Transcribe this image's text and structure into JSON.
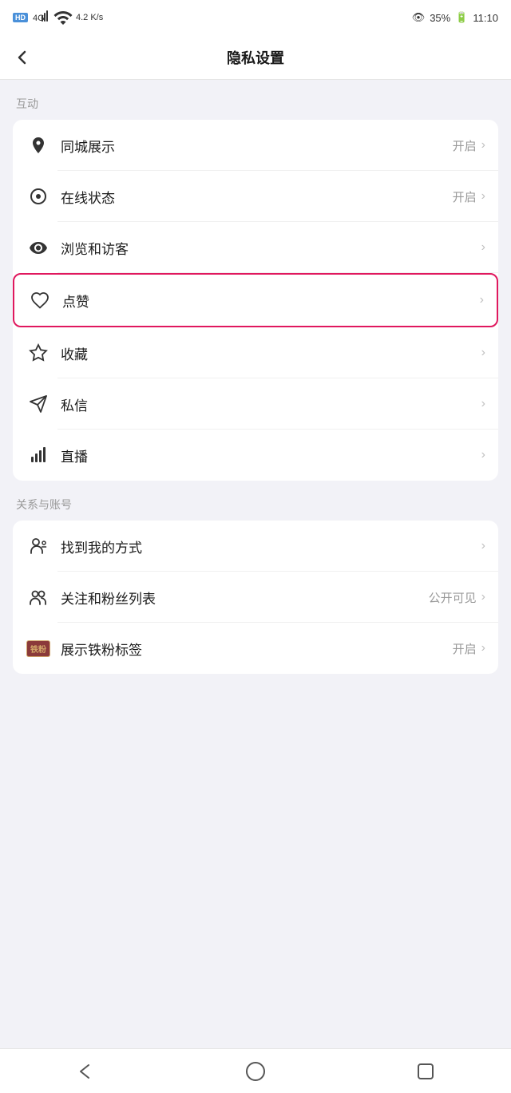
{
  "statusBar": {
    "hd": "HD",
    "network": "4G",
    "speed": "4.2\nK/s",
    "battery": "35%",
    "time": "11:10"
  },
  "header": {
    "back": "‹",
    "title": "隐私设置"
  },
  "sections": [
    {
      "label": "互动",
      "items": [
        {
          "id": "same-city",
          "icon": "location",
          "text": "同城展示",
          "value": "开启",
          "arrow": true,
          "highlighted": false
        },
        {
          "id": "online-status",
          "icon": "online",
          "text": "在线状态",
          "value": "开启",
          "arrow": true,
          "highlighted": false
        },
        {
          "id": "browse-visitor",
          "icon": "eye",
          "text": "浏览和访客",
          "value": "",
          "arrow": true,
          "highlighted": false
        },
        {
          "id": "likes",
          "icon": "heart",
          "text": "点赞",
          "value": "",
          "arrow": true,
          "highlighted": true
        },
        {
          "id": "collect",
          "icon": "star",
          "text": "收藏",
          "value": "",
          "arrow": true,
          "highlighted": false
        },
        {
          "id": "message",
          "icon": "message",
          "text": "私信",
          "value": "",
          "arrow": true,
          "highlighted": false
        },
        {
          "id": "live",
          "icon": "live",
          "text": "直播",
          "value": "",
          "arrow": true,
          "highlighted": false
        }
      ]
    },
    {
      "label": "关系与账号",
      "items": [
        {
          "id": "find-me",
          "icon": "find-person",
          "text": "找到我的方式",
          "value": "",
          "arrow": true,
          "highlighted": false
        },
        {
          "id": "follow-fans",
          "icon": "follow-fans",
          "text": "关注和粉丝列表",
          "value": "公开可见",
          "arrow": true,
          "highlighted": false
        },
        {
          "id": "iron-fan",
          "icon": "iron-fan",
          "text": "展示铁粉标签",
          "value": "开启",
          "arrow": true,
          "highlighted": false
        }
      ]
    }
  ],
  "bottomNav": {
    "back": "◁",
    "home": "○",
    "recent": "□"
  }
}
